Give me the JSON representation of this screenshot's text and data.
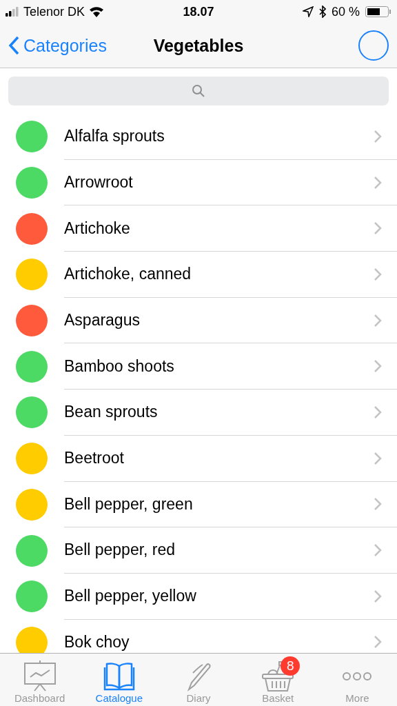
{
  "status_bar": {
    "carrier": "Telenor DK",
    "time": "18.07",
    "battery": "60 %"
  },
  "nav": {
    "back": "Categories",
    "title": "Vegetables"
  },
  "items": [
    {
      "name": "Alfalfa sprouts",
      "color": "#4cd964"
    },
    {
      "name": "Arrowroot",
      "color": "#4cd964"
    },
    {
      "name": "Artichoke",
      "color": "#ff5a3c"
    },
    {
      "name": "Artichoke, canned",
      "color": "#ffcc00"
    },
    {
      "name": "Asparagus",
      "color": "#ff5a3c"
    },
    {
      "name": "Bamboo shoots",
      "color": "#4cd964"
    },
    {
      "name": "Bean sprouts",
      "color": "#4cd964"
    },
    {
      "name": "Beetroot",
      "color": "#ffcc00"
    },
    {
      "name": "Bell pepper, green",
      "color": "#ffcc00"
    },
    {
      "name": "Bell pepper, red",
      "color": "#4cd964"
    },
    {
      "name": "Bell pepper, yellow",
      "color": "#4cd964"
    },
    {
      "name": "Bok choy",
      "color": "#ffcc00"
    }
  ],
  "tabs": [
    {
      "kind": "dashboard",
      "label": "Dashboard",
      "selected": false
    },
    {
      "kind": "catalogue",
      "label": "Catalogue",
      "selected": true
    },
    {
      "kind": "diary",
      "label": "Diary",
      "selected": false
    },
    {
      "kind": "basket",
      "label": "Basket",
      "selected": false,
      "badge": "8"
    },
    {
      "kind": "more",
      "label": "More",
      "selected": false
    }
  ]
}
